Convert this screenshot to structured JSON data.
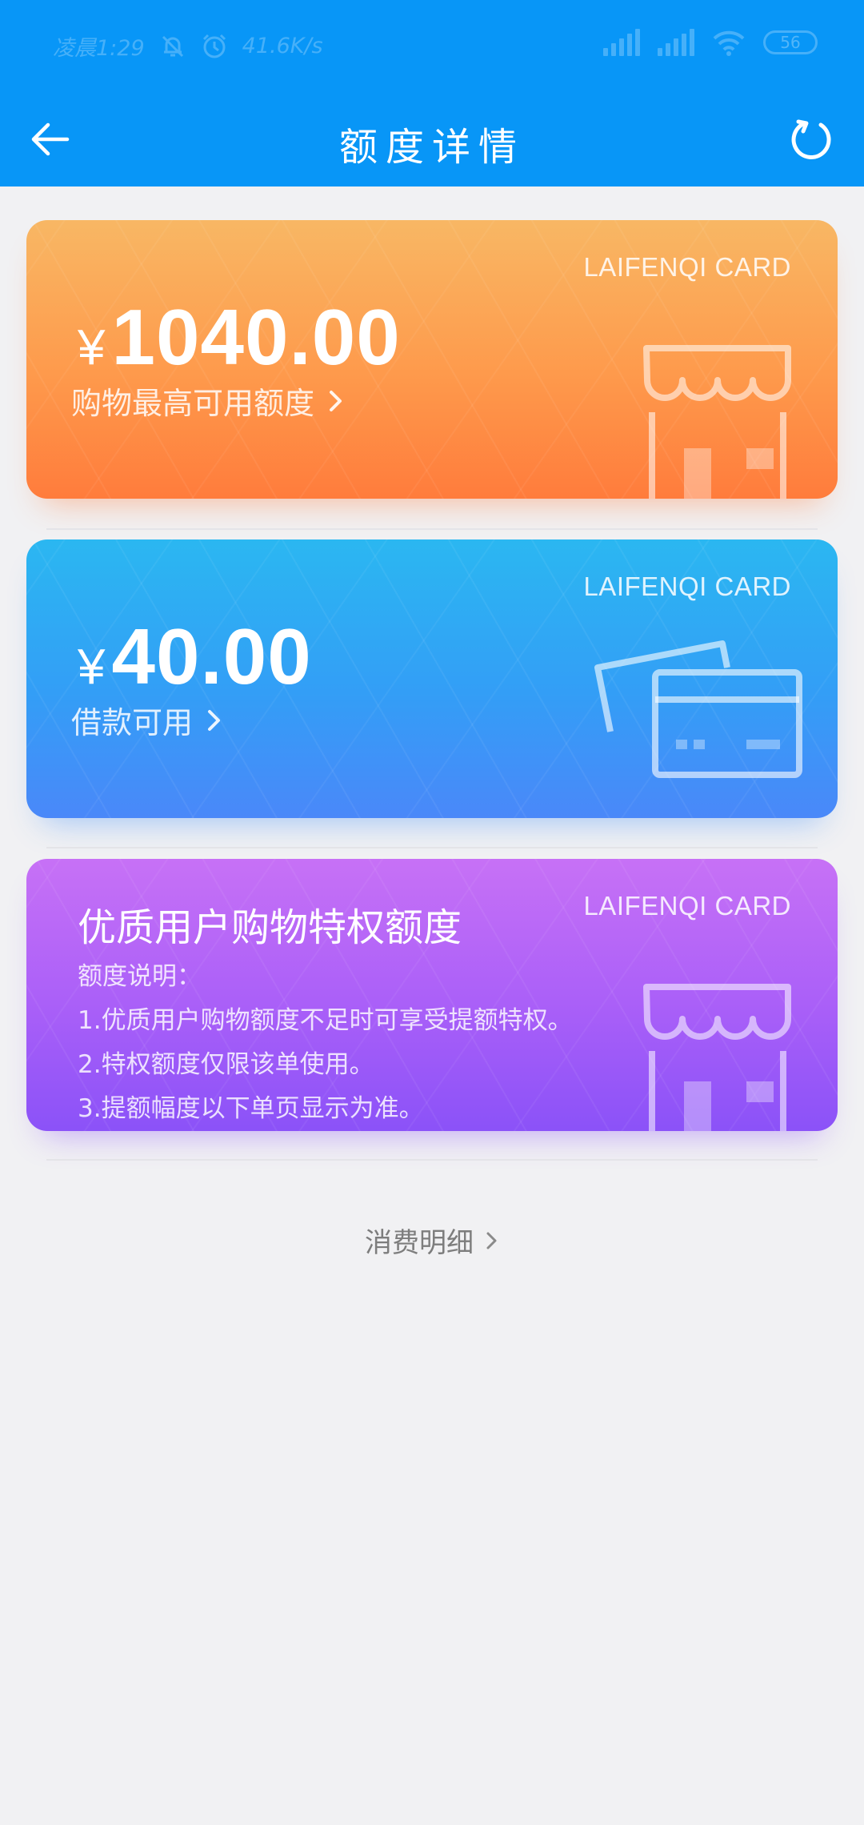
{
  "status_bar": {
    "time": "凌晨1:29",
    "speed": "41.6K/s",
    "battery": "56",
    "icons": [
      "mute-icon",
      "alarm-icon",
      "hd-signal-icon",
      "signal-icon",
      "wifi-icon",
      "battery-icon"
    ]
  },
  "header": {
    "title": "额度详情",
    "back_icon": "arrow-left-icon",
    "refresh_icon": "refresh-icon",
    "background": "#0896f7"
  },
  "cards": [
    {
      "brand": "LAIFENQI CARD",
      "currency": "¥",
      "amount": "1040.00",
      "link_label": "购物最高可用额度",
      "icon": "store-icon",
      "color": "#ff8a42"
    },
    {
      "brand": "LAIFENQI CARD",
      "currency": "¥",
      "amount": "40.00",
      "link_label": "借款可用",
      "icon": "credit-cards-icon",
      "color": "#369cf6"
    },
    {
      "brand": "LAIFENQI CARD",
      "title": "优质用户购物特权额度",
      "desc_title": "额度说明：",
      "desc_lines": [
        "1.优质用户购物额度不足时可享受提额特权。",
        "2.特权额度仅限该单使用。",
        "3.提额幅度以下单页显示为准。"
      ],
      "icon": "store-icon",
      "color": "#a05ff8"
    }
  ],
  "footer": {
    "link_label": "消费明细"
  }
}
